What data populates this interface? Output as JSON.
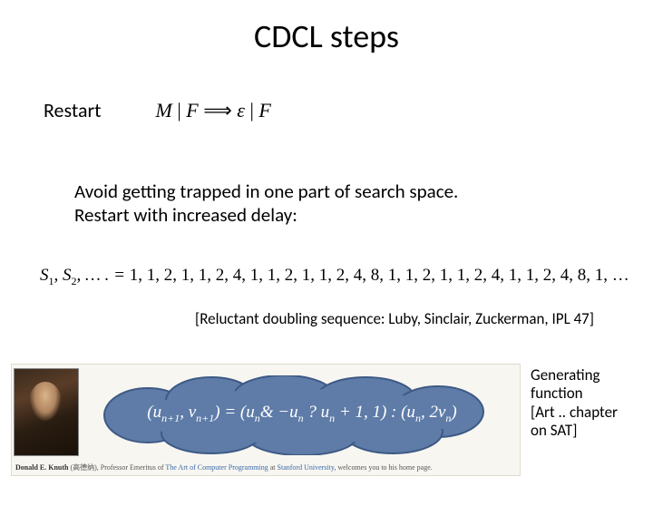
{
  "title": "CDCL steps",
  "restart": {
    "label": "Restart",
    "formula": "M | F ⟹ ε | F"
  },
  "paragraph": {
    "line1": "Avoid getting trapped in one part of search space.",
    "line2": "Restart with increased delay:"
  },
  "sequence": {
    "lhs": "S₁, S₂, … . =",
    "rhs": " 1, 1, 2, 1, 1, 2, 4, 1, 1, 2, 1, 1, 2, 4, 8, 1, 1, 2, 1, 1, 2, 4, 1, 1, 2, 4, 8, 1, …"
  },
  "citation": "[Reluctant doubling sequence: Luby, Sinclair, Zuckerman, IPL 47]",
  "cloud_formula": "(uₙ₊₁, vₙ₊₁) = (uₙ & −uₙ ? uₙ + 1, 1) : (uₙ, 2vₙ)",
  "caption": {
    "name": "Donald E. Knuth",
    "cjk": "(高德纳)",
    "role": ", Professor Emeritus of ",
    "link1": "The Art of Computer Programming",
    "mid": " at ",
    "link2": "Stanford University",
    "tail": ", welcomes you to his home page."
  },
  "side_note": {
    "l1": "Generating",
    "l2": "function",
    "l3": "[Art .. chapter",
    "l4": "on SAT]"
  }
}
